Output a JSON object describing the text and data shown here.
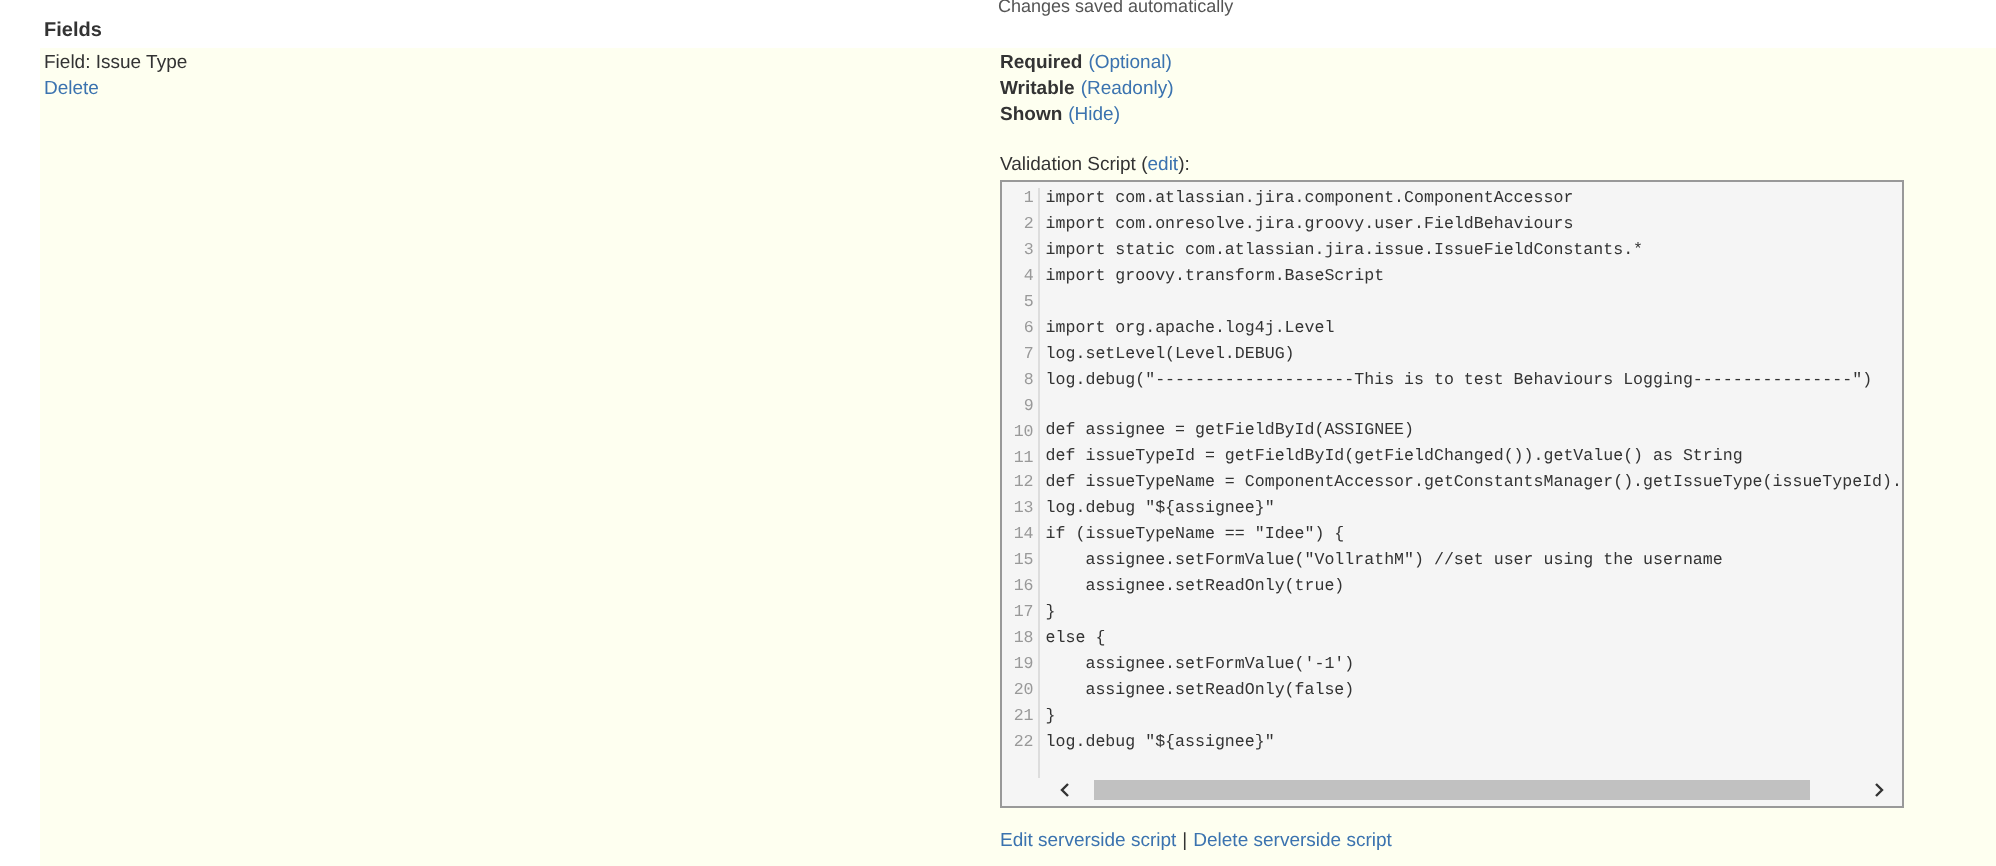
{
  "status_text": "Changes saved automatically",
  "section_title": "Fields",
  "field": {
    "label": "Field: Issue Type",
    "delete_link": "Delete"
  },
  "options": [
    {
      "name": "Required",
      "link": "(Optional)"
    },
    {
      "name": "Writable",
      "link": "(Readonly)"
    },
    {
      "name": "Shown",
      "link": "(Hide)"
    }
  ],
  "validation": {
    "label": "Validation Script",
    "edit_link": "edit",
    "suffix": "):",
    "prefix": " (",
    "lines": [
      {
        "number": "1",
        "code": "import com.atlassian.jira.component.ComponentAccessor"
      },
      {
        "number": "2",
        "code": "import com.onresolve.jira.groovy.user.FieldBehaviours"
      },
      {
        "number": "3",
        "code": "import static com.atlassian.jira.issue.IssueFieldConstants.*"
      },
      {
        "number": "4",
        "code": "import groovy.transform.BaseScript"
      },
      {
        "number": "5"
      },
      {
        "number": "6",
        "code": "import org.apache.log4j.Level"
      },
      {
        "number": "7",
        "code": "log.setLevel(Level.DEBUG)"
      },
      {
        "number": "8",
        "code": "log.debug(\"--------------------This is to test Behaviours Logging----------------\")"
      },
      {
        "number": "9"
      },
      {
        "number": "10",
        "code": "def assignee = getFieldById(ASSIGNEE)"
      },
      {
        "number": "11",
        "code": "def issueTypeId = getFieldById(getFieldChanged()).getValue() as String"
      },
      {
        "number": "12",
        "code": "def issueTypeName = ComponentAccessor.getConstantsManager().getIssueType(issueTypeId)."
      },
      {
        "number": "13",
        "code": "log.debug \"${assignee}\""
      },
      {
        "number": "14",
        "code": "if (issueTypeName == \"Idee\") {"
      },
      {
        "number": "15",
        "code": "    assignee.setFormValue(\"VollrathM\") //set user using the username"
      },
      {
        "number": "16",
        "code": "    assignee.setReadOnly(true)"
      },
      {
        "number": "17",
        "code": "}"
      },
      {
        "number": "18",
        "code": "else {"
      },
      {
        "number": "19",
        "code": "    assignee.setFormValue('-1')"
      },
      {
        "number": "20",
        "code": "    assignee.setReadOnly(false)"
      },
      {
        "number": "21",
        "code": "}"
      },
      {
        "number": "22",
        "code": "log.debug \"${assignee}\""
      }
    ]
  },
  "script_links": [
    {
      "label": "Edit serverside script"
    },
    {
      "label": "Delete serverside script"
    }
  ],
  "link_separator": "|"
}
